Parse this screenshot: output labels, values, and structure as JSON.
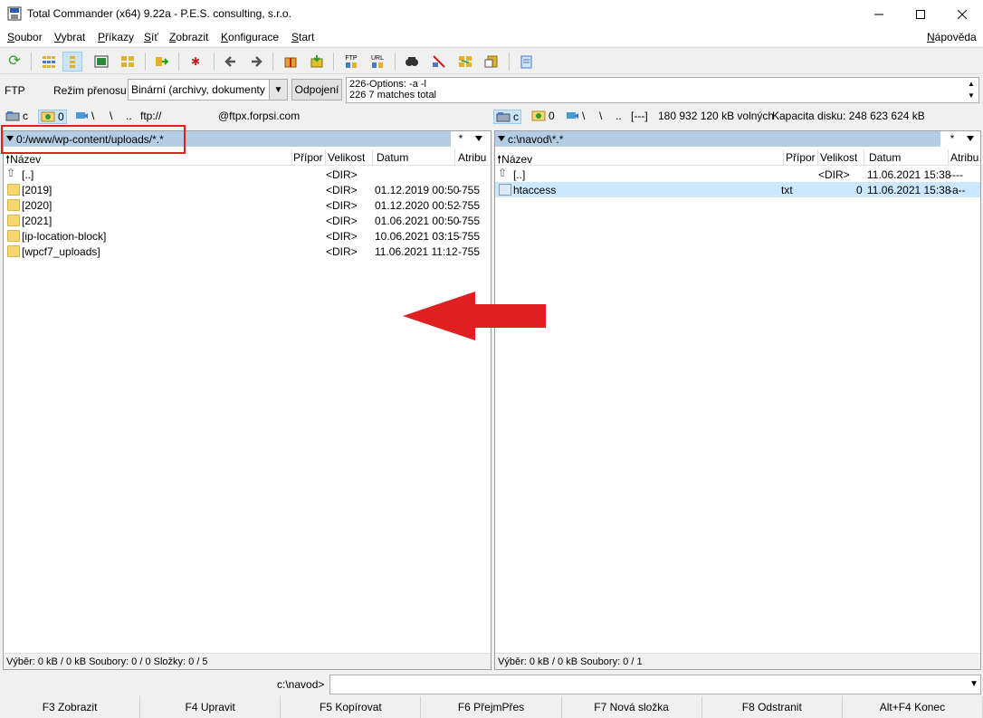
{
  "window": {
    "title": "Total Commander (x64) 9.22a - P.E.S. consulting, s.r.o."
  },
  "menu": {
    "items": [
      {
        "label": "Soubor",
        "u": "S",
        "rest": "oubor"
      },
      {
        "label": "Vybrat",
        "u": "V",
        "rest": "ybrat"
      },
      {
        "label": "Příkazy",
        "u": "P",
        "rest": "říkazy"
      },
      {
        "label": "Síť",
        "u": "S",
        "rest": "íť"
      },
      {
        "label": "Zobrazit",
        "u": "Z",
        "rest": "obrazit"
      },
      {
        "label": "Konfigurace",
        "u": "K",
        "rest": "onfigurace"
      },
      {
        "label": "Start",
        "u": "S",
        "rest": "tart"
      }
    ],
    "help": {
      "label": "Nápověda",
      "u": "N",
      "rest": "ápověda"
    }
  },
  "ftp": {
    "label": "FTP",
    "mode_label": "Režim přenosu",
    "mode_value": "Binární (archivy, dokumenty",
    "disconnect_label": "Odpojení",
    "log_line1": "226-Options: -a -l",
    "log_line2": "226 7 matches total"
  },
  "left_drives": {
    "drive_c": "c",
    "drive_0": "0",
    "net": "\\",
    "root": "\\",
    "up": "..",
    "ftp_prefix": "ftp://",
    "host": "@ftpx.forpsi.com"
  },
  "right_drives": {
    "drive_c": "c",
    "drive_0": "0",
    "net": "\\",
    "root": "\\",
    "up": "..",
    "label": "[---]",
    "free": "180 932 120 kB volných",
    "capacity": "Kapacita disku: 248 623 624 kB"
  },
  "left_panel": {
    "path": "0:/www/wp-content/uploads/*.*",
    "star": "*",
    "columns": {
      "name": "Název",
      "ext": "Přípor",
      "size": "Velikost",
      "date": "Datum",
      "attr": "Atribu"
    },
    "rows": [
      {
        "name": "[..]",
        "ext": "",
        "size": "<DIR>",
        "date": "",
        "attr": ""
      },
      {
        "name": "[2019]",
        "ext": "",
        "size": "<DIR>",
        "date": "01.12.2019 00:50",
        "attr": "-755"
      },
      {
        "name": "[2020]",
        "ext": "",
        "size": "<DIR>",
        "date": "01.12.2020 00:52",
        "attr": "-755"
      },
      {
        "name": "[2021]",
        "ext": "",
        "size": "<DIR>",
        "date": "01.06.2021 00:50",
        "attr": "-755"
      },
      {
        "name": "[ip-location-block]",
        "ext": "",
        "size": "<DIR>",
        "date": "10.06.2021 03:15",
        "attr": "-755"
      },
      {
        "name": "[wpcf7_uploads]",
        "ext": "",
        "size": "<DIR>",
        "date": "11.06.2021 11:12",
        "attr": "-755"
      }
    ],
    "status": "Výběr: 0 kB / 0 kB  Soubory: 0 / 0  Složky: 0 / 5"
  },
  "right_panel": {
    "path": "c:\\navod\\*.*",
    "star": "*",
    "columns": {
      "name": "Název",
      "ext": "Přípor",
      "size": "Velikost",
      "date": "Datum",
      "attr": "Atribu"
    },
    "rows": [
      {
        "name": "[..]",
        "ext": "",
        "size": "<DIR>",
        "date": "11.06.2021 15:38",
        "attr": "----"
      },
      {
        "name": "htaccess",
        "ext": "txt",
        "size": "0",
        "date": "11.06.2021 15:38",
        "attr": "-a--"
      }
    ],
    "status": "Výběr: 0 kB / 0 kB  Soubory: 0 / 1"
  },
  "command": {
    "path": "c:\\navod>"
  },
  "fkeys": [
    "F3 Zobrazit",
    "F4 Upravit",
    "F5 Kopírovat",
    "F6 PřejmPřes",
    "F7 Nová složka",
    "F8 Odstranit",
    "Alt+F4 Konec"
  ],
  "colors": {
    "path_bar": "#b4cde4",
    "selection": "#cce8ff",
    "annotation": "#e02020"
  }
}
